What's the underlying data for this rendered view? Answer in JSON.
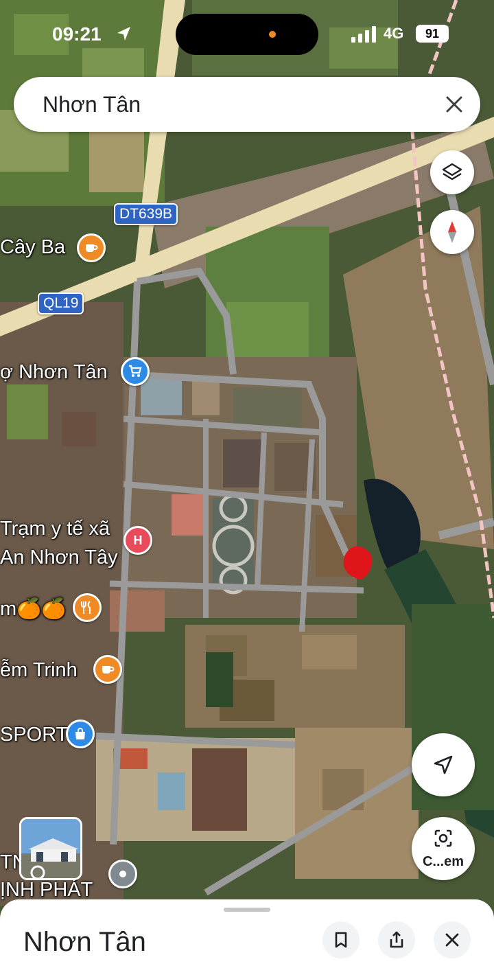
{
  "status_bar": {
    "time": "09:21",
    "network": "4G",
    "battery": "91"
  },
  "search": {
    "query": "Nhơn Tân"
  },
  "map": {
    "road_badges": [
      "DT639B",
      "QL19"
    ],
    "labels": {
      "cafe_cay_ba": "Cây Ba",
      "market": "ợ Nhơn Tân",
      "clinic_line1": "Trạm y tế xã",
      "clinic_line2": "An Nhơn Tây",
      "fruit": "m🍊🍊",
      "cafe_trinh": "ễm Trinh",
      "sport": "SPORT",
      "bottom_line1": "TN       AN",
      "bottom_line2": "ỊNH PHÁT"
    }
  },
  "camera_button": {
    "label": "C...em"
  },
  "sheet": {
    "title": "Nhơn Tân"
  },
  "colors": {
    "road_badge": "#2f64c2",
    "orange_pin": "#f08a24",
    "hospital_pin": "#e94b5a",
    "blue_pin": "#2d8ae6",
    "marker": "#e0151b"
  }
}
